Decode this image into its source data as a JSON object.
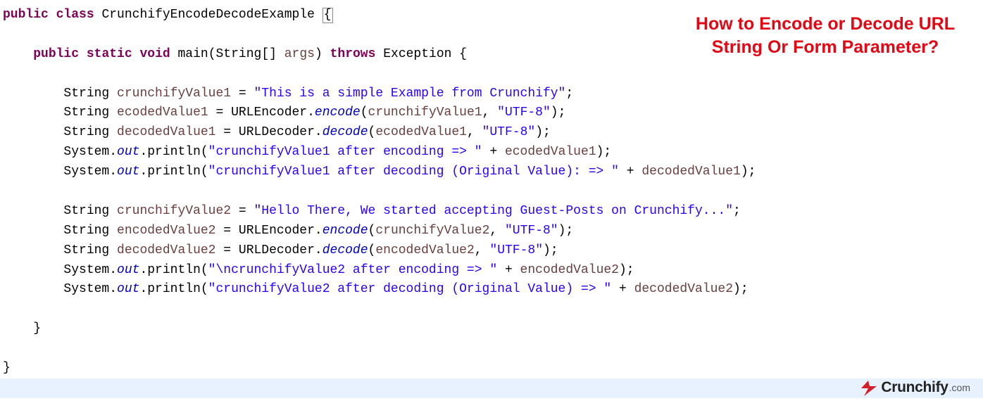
{
  "title": {
    "line1": "How to Encode or Decode URL",
    "line2": "String Or Form Parameter?"
  },
  "logo": {
    "brand": "Crunchify",
    "tld": ".com"
  },
  "code": {
    "l1": {
      "kw1": "public",
      "kw2": "class",
      "cls": "CrunchifyEncodeDecodeExample",
      "brace": "{"
    },
    "l3": {
      "kw1": "public",
      "kw2": "static",
      "kw3": "void",
      "m": "main(String[]",
      "id": "args",
      "paren": ")",
      "kw4": "throws",
      "exc": "Exception {"
    },
    "l5": {
      "type": "String",
      "id": "crunchifyValue1",
      "eq": " = ",
      "str": "\"This is a simple Example from Crunchify\"",
      "end": ";"
    },
    "l6": {
      "type": "String",
      "id": "ecodedValue1",
      "eq": " = URLEncoder.",
      "stat": "encode",
      "open": "(",
      "arg1": "crunchifyValue1",
      "comma": ", ",
      "str": "\"UTF-8\"",
      "end": ");"
    },
    "l7": {
      "type": "String",
      "id": "decodedValue1",
      "eq": " = URLDecoder.",
      "stat": "decode",
      "open": "(",
      "arg1": "ecodedValue1",
      "comma": ", ",
      "str": "\"UTF-8\"",
      "end": ");"
    },
    "l8": {
      "sys": "System.",
      "out": "out",
      "p": ".println(",
      "str": "\"crunchifyValue1 after encoding => \"",
      "plus": " + ",
      "id": "ecodedValue1",
      "end": ");"
    },
    "l9": {
      "sys": "System.",
      "out": "out",
      "p": ".println(",
      "str": "\"crunchifyValue1 after decoding (Original Value): => \"",
      "plus": " + ",
      "id": "decodedValue1",
      "end": ");"
    },
    "l11": {
      "type": "String",
      "id": "crunchifyValue2",
      "eq": " = ",
      "str": "\"Hello There, We started accepting Guest-Posts on Crunchify...\"",
      "end": ";"
    },
    "l12": {
      "type": "String",
      "id": "encodedValue2",
      "eq": " = URLEncoder.",
      "stat": "encode",
      "open": "(",
      "arg1": "crunchifyValue2",
      "comma": ", ",
      "str": "\"UTF-8\"",
      "end": ");"
    },
    "l13": {
      "type": "String",
      "id": "decodedValue2",
      "eq": " = URLDecoder.",
      "stat": "decode",
      "open": "(",
      "arg1": "encodedValue2",
      "comma": ", ",
      "str": "\"UTF-8\"",
      "end": ");"
    },
    "l14": {
      "sys": "System.",
      "out": "out",
      "p": ".println(",
      "str": "\"\\ncrunchifyValue2 after encoding => \"",
      "plus": " + ",
      "id": "encodedValue2",
      "end": ");"
    },
    "l15": {
      "sys": "System.",
      "out": "out",
      "p": ".println(",
      "str": "\"crunchifyValue2 after decoding (Original Value) => \"",
      "plus": " + ",
      "id": "decodedValue2",
      "end": ");"
    },
    "l17": "    }",
    "l19": "}"
  }
}
